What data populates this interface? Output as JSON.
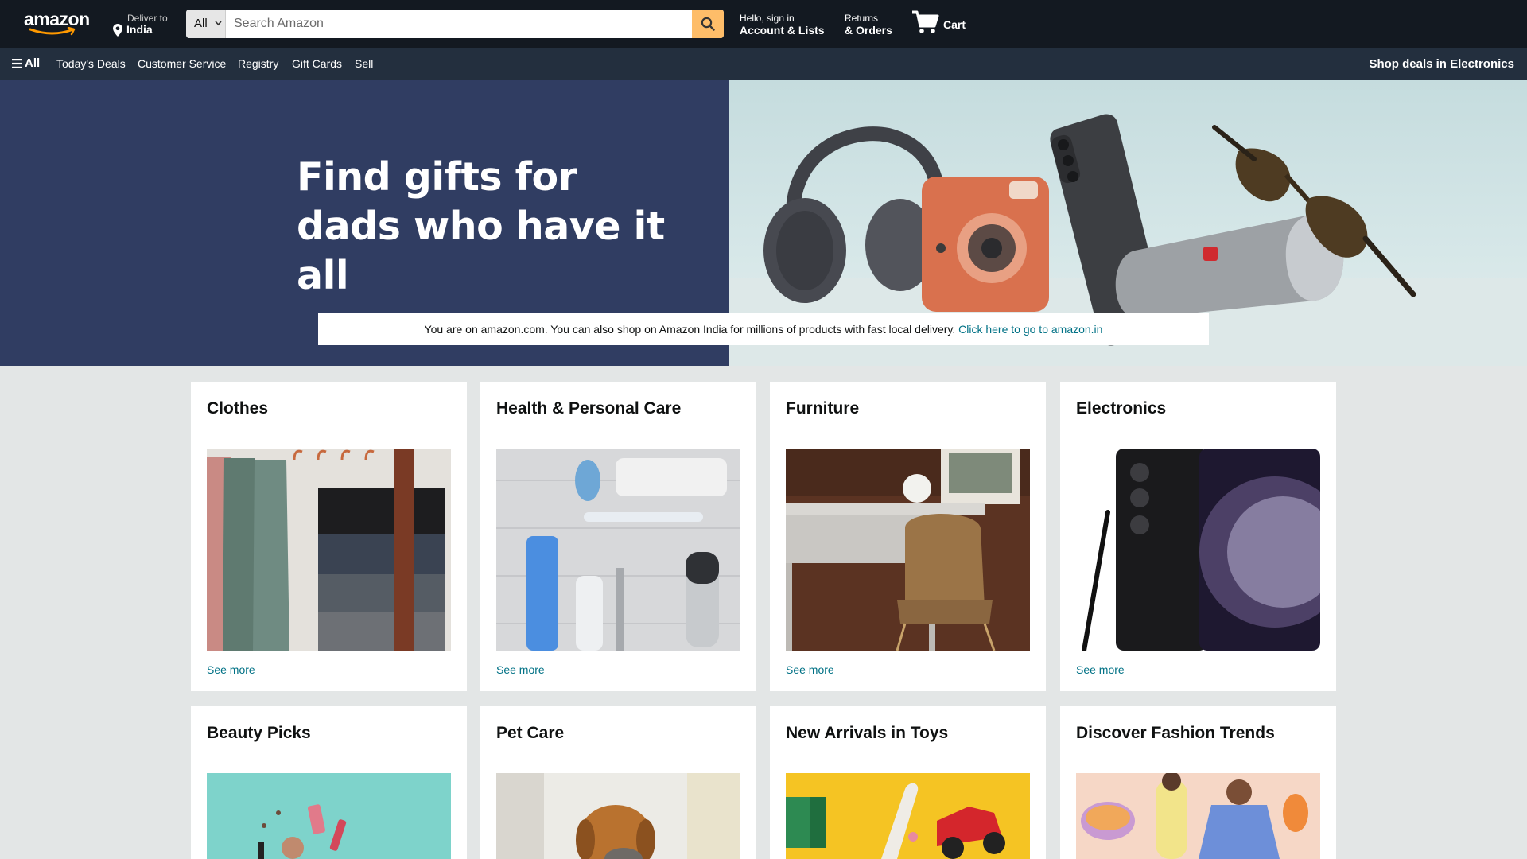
{
  "header": {
    "logo_text": "amazon",
    "deliver_line1": "Deliver to",
    "deliver_line2": "India",
    "search": {
      "category": "All",
      "placeholder": "Search Amazon"
    },
    "account_line1": "Hello, sign in",
    "account_line2": "Account & Lists",
    "returns_line1": "Returns",
    "returns_line2": "& Orders",
    "cart_label": "Cart"
  },
  "subnav": {
    "all_label": "All",
    "items": [
      "Today's Deals",
      "Customer Service",
      "Registry",
      "Gift Cards",
      "Sell"
    ],
    "right_label": "Shop deals in Electronics"
  },
  "hero": {
    "title_line1": "Find gifts for",
    "title_line2": "dads who have it all"
  },
  "banner": {
    "text": "You are on amazon.com. You can also shop on Amazon India for millions of products with fast local delivery.",
    "link_text": "Click here to go to amazon.in"
  },
  "cards": [
    {
      "title": "Clothes",
      "link": "See more"
    },
    {
      "title": "Health & Personal Care",
      "link": "See more"
    },
    {
      "title": "Furniture",
      "link": "See more"
    },
    {
      "title": "Electronics",
      "link": "See more"
    },
    {
      "title": "Beauty Picks",
      "link": ""
    },
    {
      "title": "Pet Care",
      "link": ""
    },
    {
      "title": "New Arrivals in Toys",
      "link": ""
    },
    {
      "title": "Discover Fashion Trends",
      "link": ""
    }
  ],
  "colors": {
    "nav_top": "#131921",
    "nav_sub": "#232f3e",
    "search_button": "#febd69",
    "hero_left": "#303d62",
    "link": "#007185",
    "page_bg": "#e3e6e6"
  },
  "icons": [
    "smile-logo-icon",
    "location-pin-icon",
    "chevron-down-icon",
    "search-icon",
    "cart-icon",
    "hamburger-menu-icon"
  ]
}
